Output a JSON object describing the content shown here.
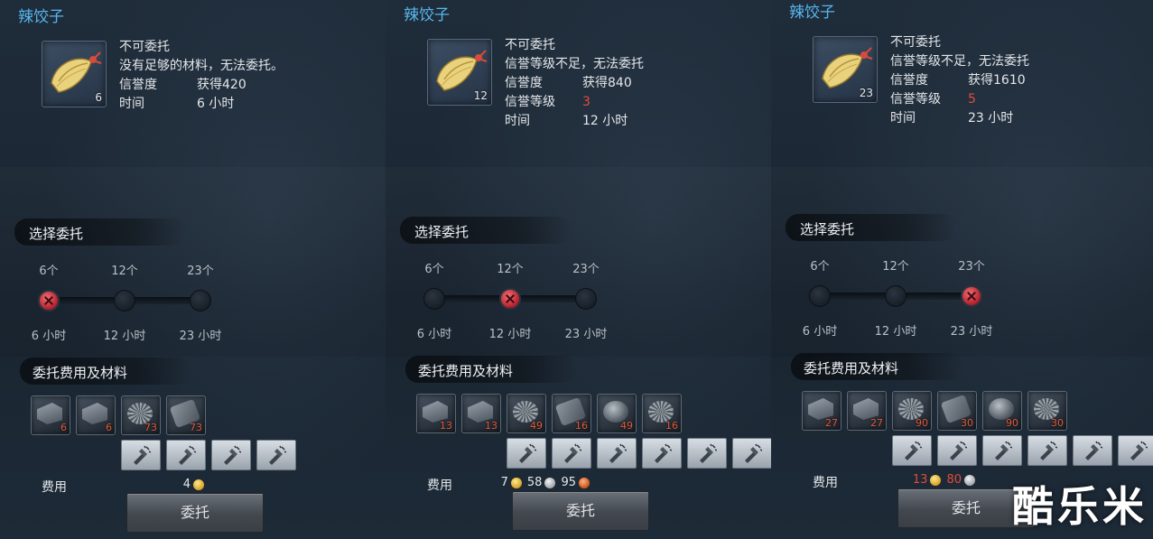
{
  "panels": [
    {
      "title": "辣饺子",
      "item_count": "6",
      "status_title": "不可委托",
      "status_desc": "没有足够的材料，无法委托。",
      "rows": [
        {
          "key": "信誉度",
          "value": "获得420",
          "red": false
        },
        {
          "key": "时间",
          "value": "6 小时",
          "red": false
        }
      ],
      "select_label": "选择委托",
      "options": [
        {
          "count": "6个",
          "time": "6 小时"
        },
        {
          "count": "12个",
          "time": "12 小时"
        },
        {
          "count": "23个",
          "time": "23 小时"
        }
      ],
      "selected_index": 0,
      "materials_label": "委托费用及材料",
      "materials": [
        "6",
        "6",
        "73",
        "73"
      ],
      "fee_label": "费用",
      "fees": [
        {
          "value": "4",
          "coin": "gold",
          "red": false
        }
      ],
      "button_label": "委托"
    },
    {
      "title": "辣饺子",
      "item_count": "12",
      "status_title": "不可委托",
      "status_desc": "信誉等级不足，无法委托",
      "rows": [
        {
          "key": "信誉度",
          "value": "获得840",
          "red": false
        },
        {
          "key": "信誉等级",
          "value": "3",
          "red": true
        },
        {
          "key": "时间",
          "value": "12 小时",
          "red": false
        }
      ],
      "select_label": "选择委托",
      "options": [
        {
          "count": "6个",
          "time": "6 小时"
        },
        {
          "count": "12个",
          "time": "12 小时"
        },
        {
          "count": "23个",
          "time": "23 小时"
        }
      ],
      "selected_index": 1,
      "materials_label": "委托费用及材料",
      "materials": [
        "13",
        "13",
        "49",
        "16",
        "49",
        "16"
      ],
      "fee_label": "费用",
      "fees": [
        {
          "value": "7",
          "coin": "gold",
          "red": false
        },
        {
          "value": "58",
          "coin": "silver",
          "red": false
        },
        {
          "value": "95",
          "coin": "copper",
          "red": false
        }
      ],
      "button_label": "委托"
    },
    {
      "title": "辣饺子",
      "item_count": "23",
      "status_title": "不可委托",
      "status_desc": "信誉等级不足，无法委托",
      "rows": [
        {
          "key": "信誉度",
          "value": "获得1610",
          "red": false
        },
        {
          "key": "信誉等级",
          "value": "5",
          "red": true
        },
        {
          "key": "时间",
          "value": "23 小时",
          "red": false
        }
      ],
      "select_label": "选择委托",
      "options": [
        {
          "count": "6个",
          "time": "6 小时"
        },
        {
          "count": "12个",
          "time": "12 小时"
        },
        {
          "count": "23个",
          "time": "23 小时"
        }
      ],
      "selected_index": 2,
      "materials_label": "委托费用及材料",
      "materials": [
        "27",
        "27",
        "90",
        "30",
        "90",
        "30"
      ],
      "fee_label": "费用",
      "fees": [
        {
          "value": "13",
          "coin": "gold",
          "red": true
        },
        {
          "value": "80",
          "coin": "silver",
          "red": true
        }
      ],
      "button_label": "委托"
    }
  ],
  "watermark": "酷乐米"
}
